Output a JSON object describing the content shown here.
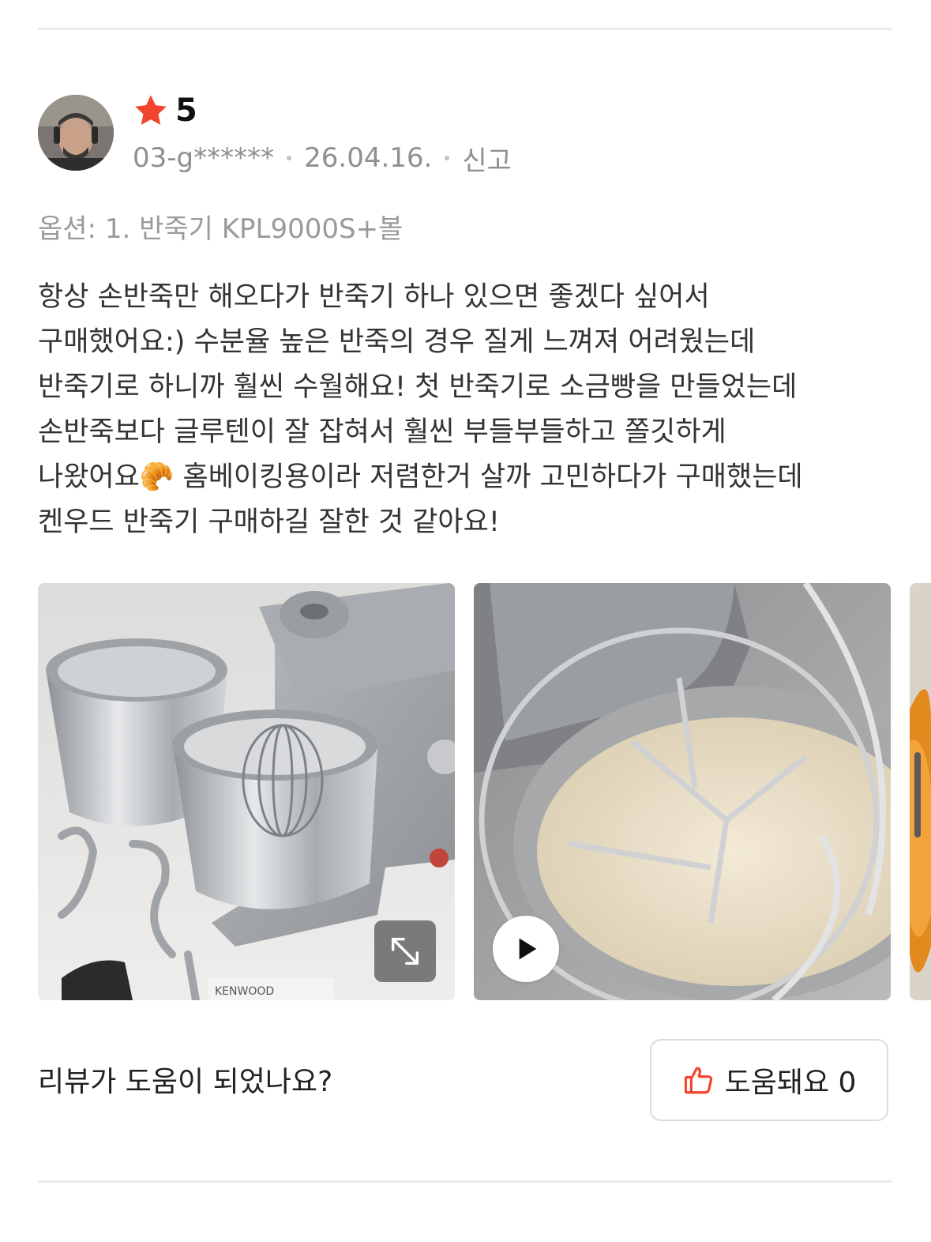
{
  "review": {
    "rating": "5",
    "author": "03-g******",
    "date": "26.04.16.",
    "report_label": "신고",
    "option": "옵션: 1. 반죽기 KPL9000S+볼",
    "body_lines": [
      "항상 손반죽만 해오다가 반죽기 하나 있으면 좋겠다 싶어서",
      "구매했어요:) 수분율 높은 반죽의 경우 질게 느껴져 어려웠는데",
      "반죽기로 하니까 훨씬 수월해요! 첫 반죽기로 소금빵을 만들었는데",
      "손반죽보다 글루텐이 잘 잡혀서 훨씬 부들부들하고 쫄깃하게",
      "나왔어요🥐 홈베이킹용이라 저렴한거 살까 고민하다가 구매했는데",
      "켄우드 반죽기 구매하길 잘한 것 같아요!"
    ],
    "photo_caption": "KENWOOD"
  },
  "feedback": {
    "question": "리뷰가 도움이 되었나요?",
    "helpful_label": "도움돼요 0"
  },
  "icons": {
    "star": "star-icon",
    "thumbs_up": "thumbs-up-icon",
    "expand": "expand-icon",
    "play": "play-icon"
  },
  "colors": {
    "accent": "#f2452d",
    "meta_text": "#8f8f8f"
  }
}
